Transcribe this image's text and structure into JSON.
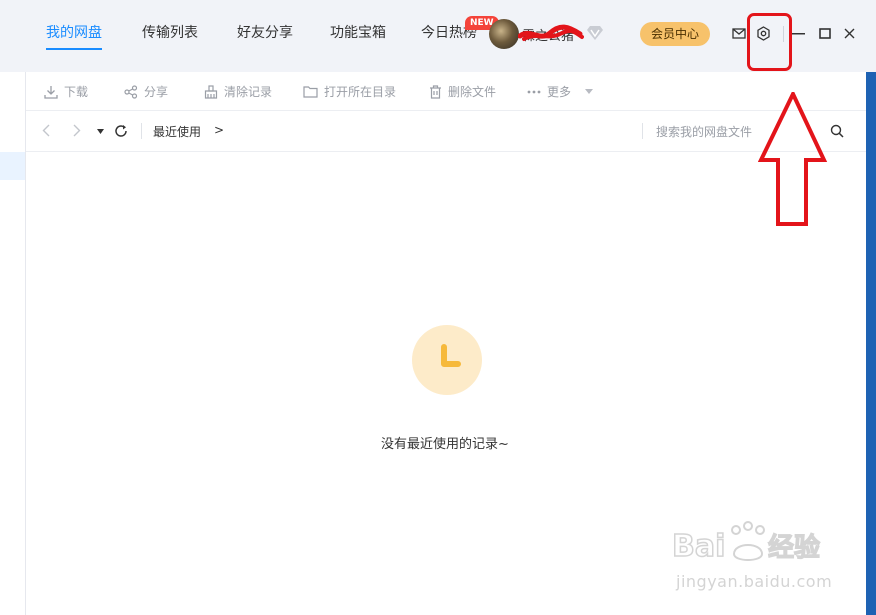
{
  "header": {
    "tabs": [
      {
        "label": "我的网盘",
        "active": true
      },
      {
        "label": "传输列表",
        "active": false
      },
      {
        "label": "好友分享",
        "active": false
      },
      {
        "label": "功能宝箱",
        "active": false
      },
      {
        "label": "今日热榜",
        "active": false,
        "badge": "NEW"
      }
    ],
    "username": "霖之公猪",
    "vip_button": "会员中心",
    "controls": [
      "mail-icon",
      "settings-icon",
      "minimize-icon",
      "maximize-icon",
      "close-icon"
    ]
  },
  "toolbar": {
    "items": [
      {
        "label": "下载",
        "icon": "download-icon"
      },
      {
        "label": "分享",
        "icon": "share-icon"
      },
      {
        "label": "清除记录",
        "icon": "clear-icon"
      },
      {
        "label": "打开所在目录",
        "icon": "folder-icon"
      },
      {
        "label": "删除文件",
        "icon": "trash-icon"
      },
      {
        "label": "更多",
        "icon": "more-icon"
      }
    ]
  },
  "nav": {
    "breadcrumb": "最近使用",
    "breadcrumb_arrow": ">",
    "search_placeholder": "搜索我的网盘文件"
  },
  "empty": {
    "message": "没有最近使用的记录~"
  },
  "watermark": {
    "logo_text": "Baidu经验",
    "url": "jingyan.baidu.com"
  },
  "colors": {
    "accent": "#1a8cff",
    "vip": "#f7c26b",
    "annotation": "#e3141a",
    "empty_icon_bg": "#fdebc9",
    "empty_icon_fg": "#f6b93b"
  }
}
